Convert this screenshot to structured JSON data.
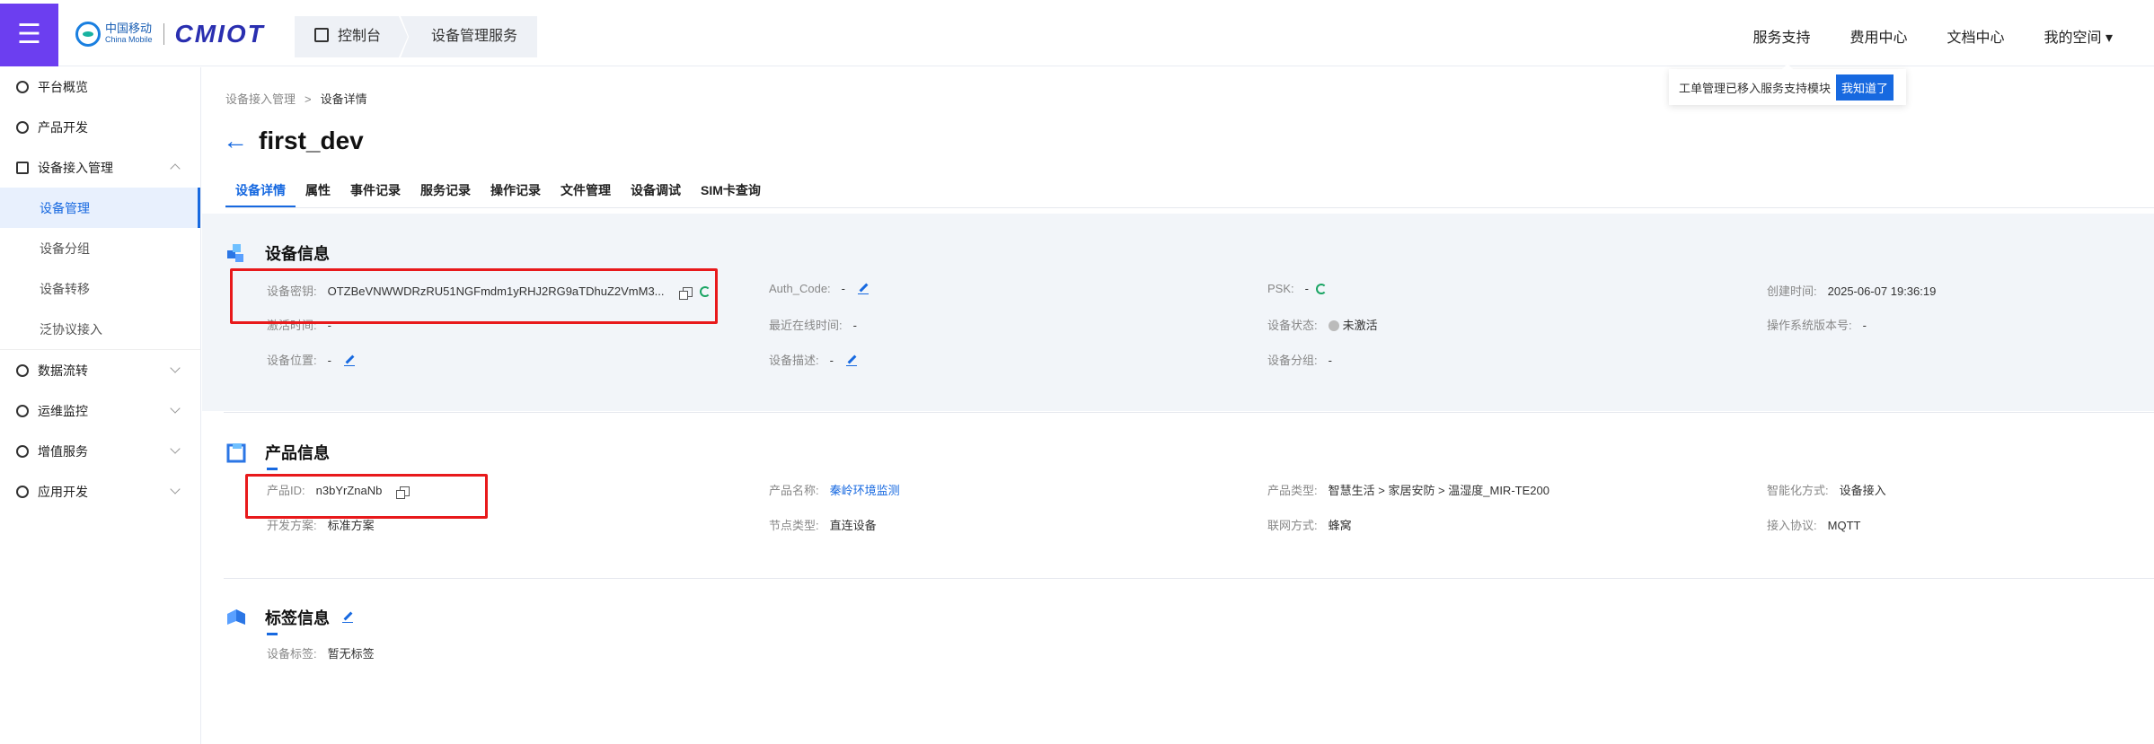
{
  "top": {
    "menu_icon": "menu-icon",
    "logo_cn": "中国移动",
    "logo_en": "China Mobile",
    "logo_brand": "CMIOT",
    "crumb_console": "控制台",
    "crumb_service": "设备管理服务",
    "nav": [
      "服务支持",
      "费用中心",
      "文档中心",
      "我的空间"
    ],
    "tip_text": "工单管理已移入服务支持模块",
    "tip_btn": "我知道了"
  },
  "sidebar": {
    "items": [
      {
        "label": "平台概览",
        "icon": "overview-icon"
      },
      {
        "label": "产品开发",
        "icon": "cube-icon"
      },
      {
        "label": "设备接入管理",
        "icon": "device-icon",
        "expanded": true
      },
      {
        "label": "设备管理",
        "sub": true,
        "active": true
      },
      {
        "label": "设备分组",
        "sub": true
      },
      {
        "label": "设备转移",
        "sub": true
      },
      {
        "label": "泛协议接入",
        "sub": true
      },
      {
        "label": "数据流转",
        "icon": "flow-icon"
      },
      {
        "label": "运维监控",
        "icon": "monitor-icon"
      },
      {
        "label": "增值服务",
        "icon": "send-icon"
      },
      {
        "label": "应用开发",
        "icon": "app-icon"
      }
    ]
  },
  "breadcrumb": {
    "parent": "设备接入管理",
    "sep": ">",
    "current": "设备详情"
  },
  "device_name": "first_dev",
  "tabs": [
    "设备详情",
    "属性",
    "事件记录",
    "服务记录",
    "操作记录",
    "文件管理",
    "设备调试",
    "SIM卡查询"
  ],
  "device_info": {
    "title": "设备信息",
    "key_label": "设备密钥:",
    "key_value": "OTZBeVNWWDRzRU51NGFmdm1yRHJ2RG9aTDhuZ2VmM3...",
    "auth_label": "Auth_Code:",
    "auth_value": "-",
    "psk_label": "PSK:",
    "psk_value": "-",
    "created_label": "创建时间:",
    "created_value": "2025-06-07 19:36:19",
    "activated_label": "激活时间:",
    "activated_value": "-",
    "online_label": "最近在线时间:",
    "online_value": "-",
    "status_label": "设备状态:",
    "status_value": "未激活",
    "os_label": "操作系统版本号:",
    "os_value": "-",
    "location_label": "设备位置:",
    "location_value": "-",
    "desc_label": "设备描述:",
    "desc_value": "-",
    "group_label": "设备分组:",
    "group_value": "-"
  },
  "product_info": {
    "title": "产品信息",
    "id_label": "产品ID:",
    "id_value": "n3bYrZnaNb",
    "name_label": "产品名称:",
    "name_value": "秦岭环境监测",
    "type_label": "产品类型:",
    "type_value": "智慧生活 > 家居安防 > 温湿度_MIR-TE200",
    "smart_label": "智能化方式:",
    "smart_value": "设备接入",
    "dev_label": "开发方案:",
    "dev_value": "标准方案",
    "node_label": "节点类型:",
    "node_value": "直连设备",
    "net_label": "联网方式:",
    "net_value": "蜂窝",
    "proto_label": "接入协议:",
    "proto_value": "MQTT"
  },
  "tag_info": {
    "title": "标签信息",
    "tag_label": "设备标签:",
    "tag_value": "暂无标签"
  }
}
